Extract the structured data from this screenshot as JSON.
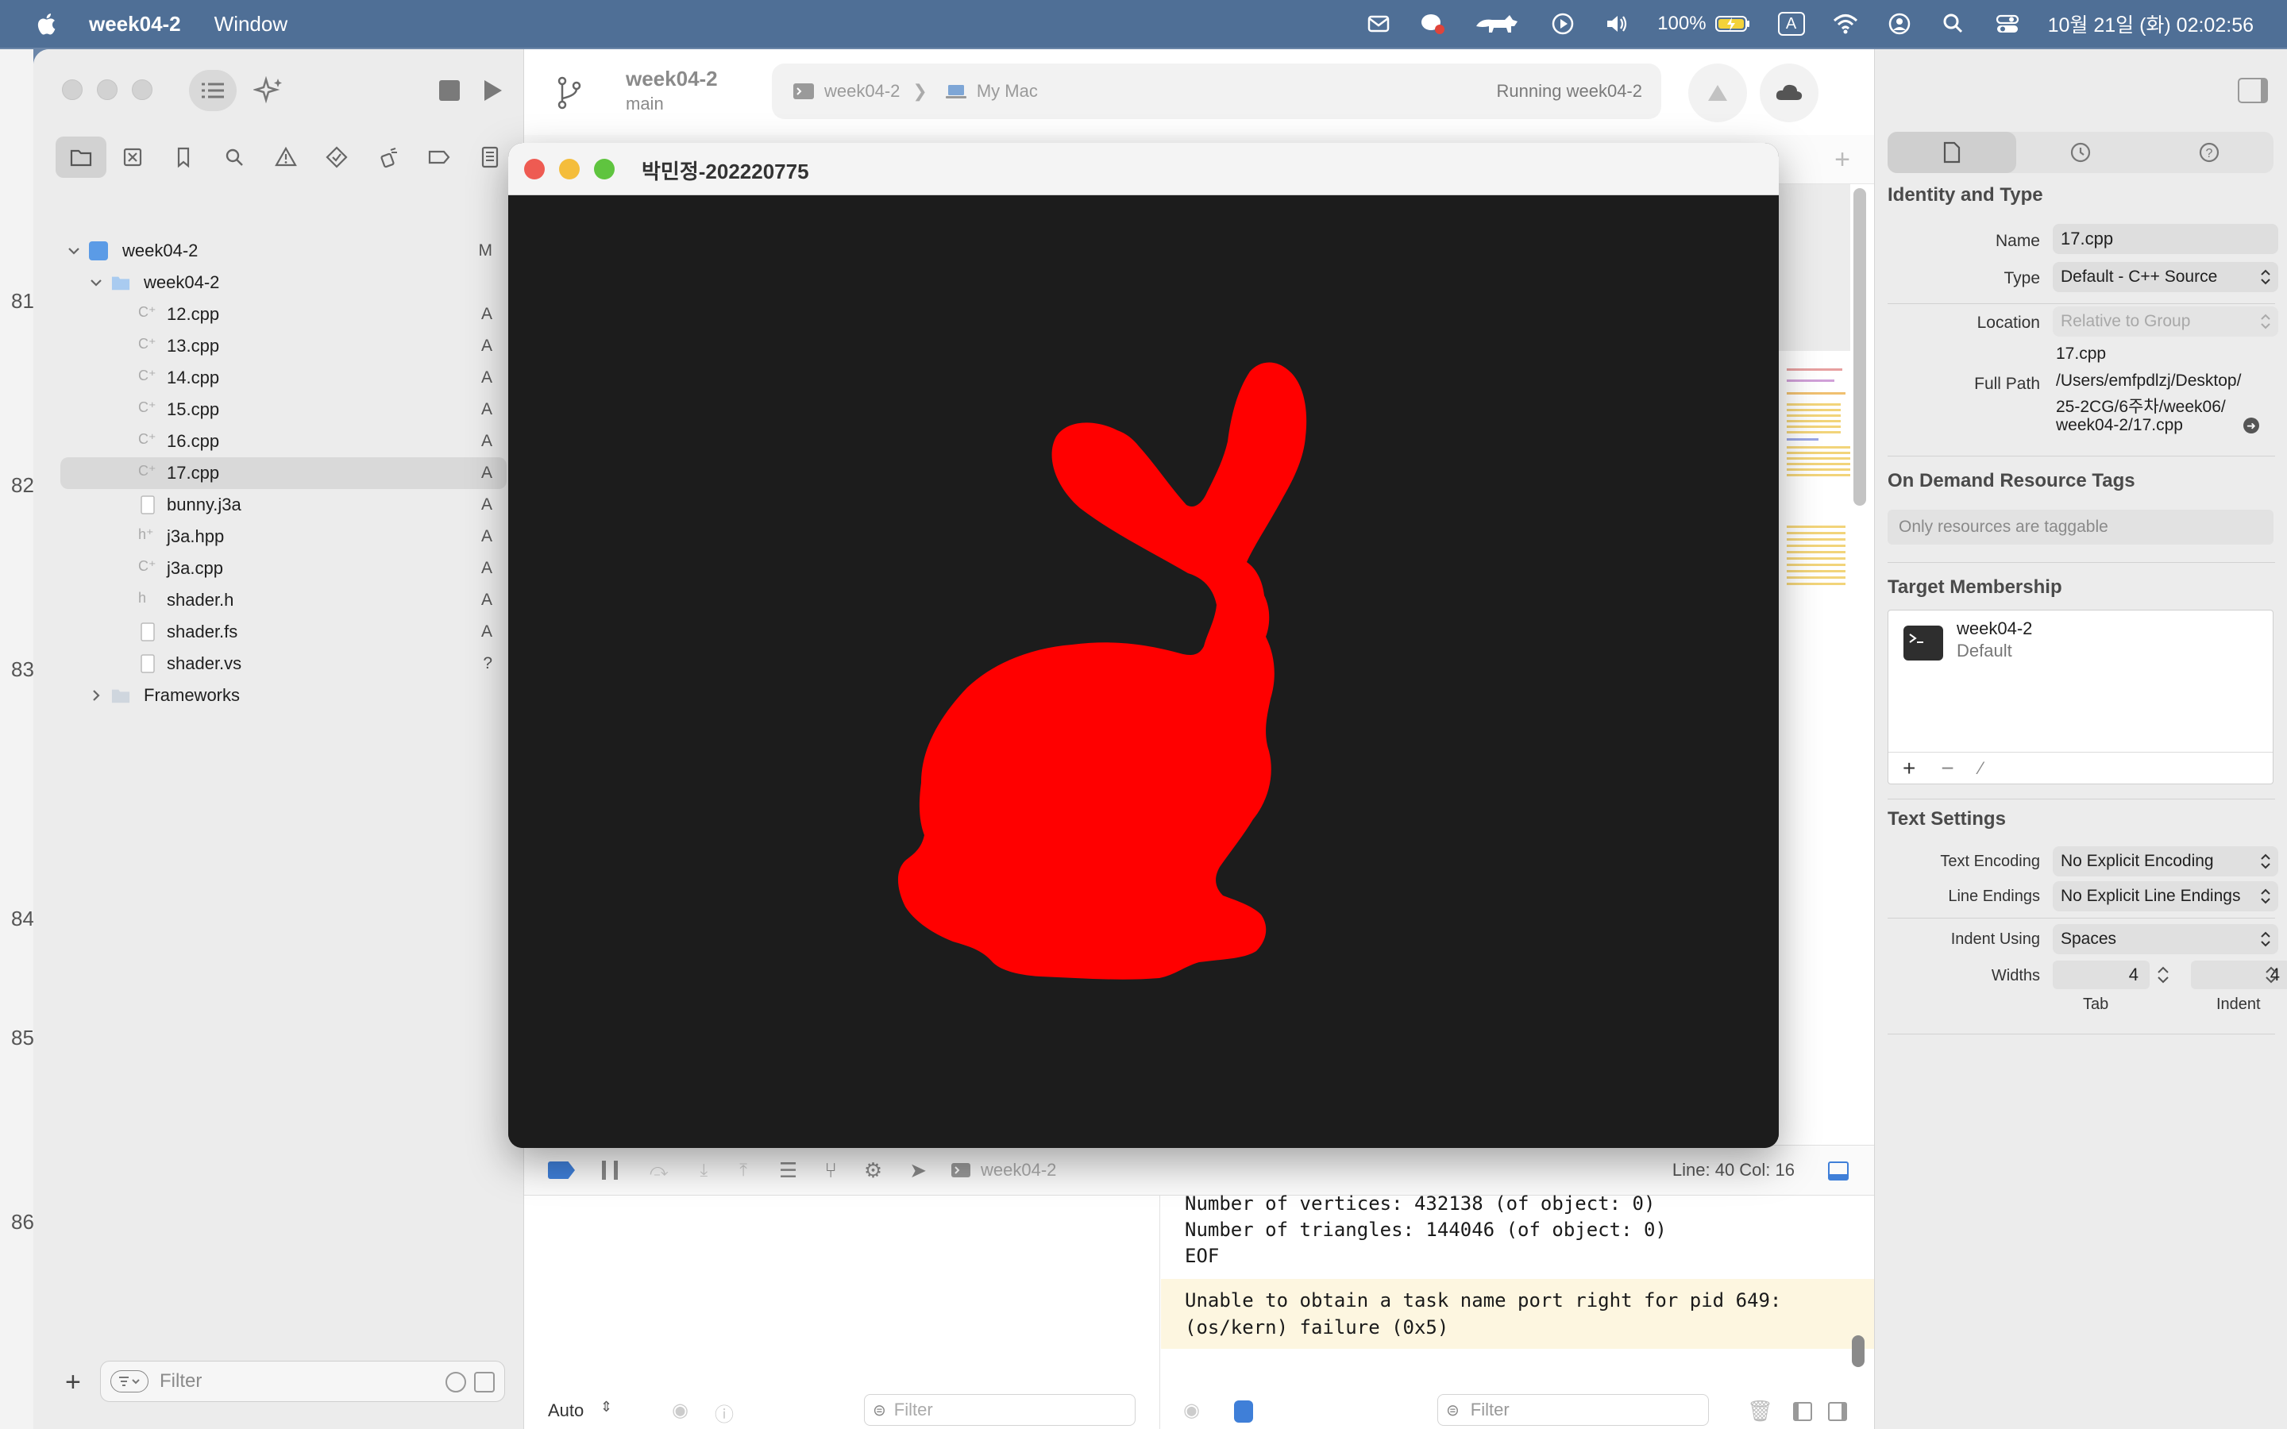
{
  "menubar": {
    "app_name": "week04-2",
    "menu_window": "Window",
    "battery": "100%",
    "input_method": "A",
    "clock": "10월 21일 (화) 02:02:56"
  },
  "xcode": {
    "project": {
      "name": "week04-2",
      "branch": "main"
    },
    "toolbar": {
      "scheme": "week04-2",
      "destination": "My Mac",
      "status": "Running week04-2"
    },
    "tree": [
      {
        "name": "week04-2",
        "status": "M",
        "kind": "project"
      },
      {
        "name": "week04-2",
        "status": "",
        "kind": "folder"
      },
      {
        "name": "12.cpp",
        "status": "A",
        "kind": "cpp"
      },
      {
        "name": "13.cpp",
        "status": "A",
        "kind": "cpp"
      },
      {
        "name": "14.cpp",
        "status": "A",
        "kind": "cpp"
      },
      {
        "name": "15.cpp",
        "status": "A",
        "kind": "cpp"
      },
      {
        "name": "16.cpp",
        "status": "A",
        "kind": "cpp"
      },
      {
        "name": "17.cpp",
        "status": "A",
        "kind": "cpp"
      },
      {
        "name": "bunny.j3a",
        "status": "A",
        "kind": "file"
      },
      {
        "name": "j3a.hpp",
        "status": "A",
        "kind": "hpp"
      },
      {
        "name": "j3a.cpp",
        "status": "A",
        "kind": "cpp"
      },
      {
        "name": "shader.h",
        "status": "A",
        "kind": "h"
      },
      {
        "name": "shader.fs",
        "status": "A",
        "kind": "file"
      },
      {
        "name": "shader.vs",
        "status": "?",
        "kind": "file"
      },
      {
        "name": "Frameworks",
        "status": "",
        "kind": "folder"
      }
    ],
    "sidebar_filter_placeholder": "Filter",
    "gutter_numbers": [
      "81",
      "82",
      "83",
      "84",
      "85",
      "86"
    ],
    "debug_bar": {
      "target": "week04-2",
      "line_col": "Line: 40  Col: 16"
    },
    "console": {
      "line1": "Number of vertices: 432138 (of object: 0)",
      "line2": "Number of triangles: 144046 (of object: 0)",
      "line3": "EOF",
      "warning": "Unable to obtain a task name port right for pid 649:\n(os/kern) failure (0x5)"
    },
    "bottom": {
      "auto": "Auto",
      "filter_left": "Filter",
      "filter_right": "Filter"
    }
  },
  "inspector": {
    "identity_title": "Identity and Type",
    "name_label": "Name",
    "name_value": "17.cpp",
    "type_label": "Type",
    "type_value": "Default - C++ Source",
    "location_label": "Location",
    "location_value": "Relative to Group",
    "location_file": "17.cpp",
    "full_path_label": "Full Path",
    "full_path_1": "/Users/emfpdlzj/Desktop/",
    "full_path_2": "25-2CG/6주차/week06/",
    "full_path_3": "week04-2/17.cpp",
    "odr_title": "On Demand Resource Tags",
    "odr_placeholder": "Only resources are taggable",
    "target_title": "Target Membership",
    "target_name": "week04-2",
    "target_sub": "Default",
    "text_settings_title": "Text Settings",
    "encoding_label": "Text Encoding",
    "encoding_value": "No Explicit Encoding",
    "line_endings_label": "Line Endings",
    "line_endings_value": "No Explicit Line Endings",
    "indent_label": "Indent Using",
    "indent_value": "Spaces",
    "widths_label": "Widths",
    "tab_value": "4",
    "indent_width_value": "4",
    "tab_caption": "Tab",
    "indent_caption": "Indent"
  },
  "app_window": {
    "title": "박민정-202220775",
    "bunny_color": "#ff0000",
    "background": "#1c1c1c"
  }
}
